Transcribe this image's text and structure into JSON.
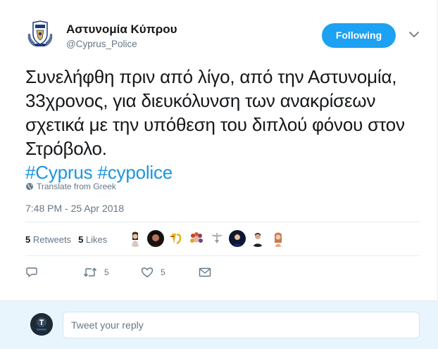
{
  "account": {
    "name": "Αστυνομία Κύπρου",
    "handle": "@Cyprus_Police"
  },
  "follow_button": {
    "label": "Following",
    "color": "#1da1f2"
  },
  "tweet": {
    "text": "Συνελήφθη πριν από λίγο, από την Αστυνομία, 33χρονος, για διευκόλυνση των ανακρίσεων σχετικά με την υπόθεση του διπλού φόνου στον Στρόβολο.",
    "hashtags": [
      "#Cyprus",
      "#cypolice"
    ],
    "hashtag_color": "#1b95e0",
    "translate_label": "Translate from Greek",
    "timestamp": "7:48 PM - 25 Apr 2018"
  },
  "stats": {
    "retweets_count": "5",
    "retweets_label": "Retweets",
    "likes_count": "5",
    "likes_label": "Likes"
  },
  "liker_avatars": [
    "avatar-1",
    "avatar-2",
    "avatar-3",
    "avatar-4",
    "avatar-5",
    "avatar-6",
    "avatar-7",
    "avatar-8"
  ],
  "actions": {
    "reply_icon": "reply-icon",
    "retweet_icon": "retweet-icon",
    "retweet_count": "5",
    "like_icon": "heart-icon",
    "like_count": "5",
    "dm_icon": "envelope-icon"
  },
  "reply_box": {
    "placeholder": "Tweet your reply"
  }
}
